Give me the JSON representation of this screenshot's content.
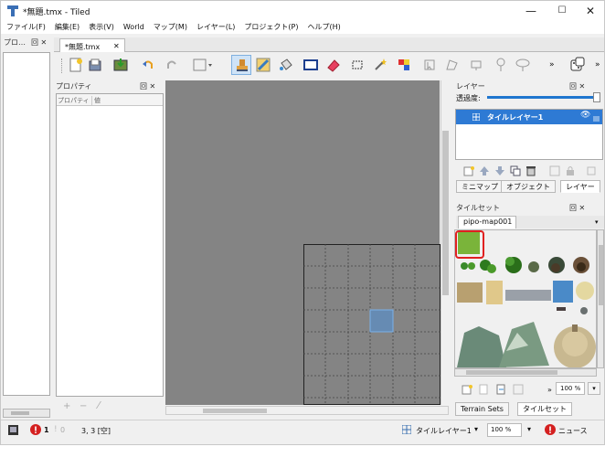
{
  "window": {
    "title": "*無題.tmx - Tiled",
    "min_glyph": "—",
    "max_glyph": "☐",
    "close_glyph": "✕"
  },
  "menu": [
    "ファイル(F)",
    "編集(E)",
    "表示(V)",
    "World",
    "マップ(M)",
    "レイヤー(L)",
    "プロジェクト(P)",
    "ヘルプ(H)"
  ],
  "left_dock": {
    "title": "プロ…",
    "ctrl": "回 ✕"
  },
  "doc_tab": {
    "label": "*無題.tmx",
    "close": "✕"
  },
  "toolbar": {
    "icons": [
      "new-map-icon",
      "open-icon",
      "save-icon",
      "undo-icon",
      "redo-icon",
      "stamp-tool-icon",
      "terrain-brush-icon",
      "bucket-fill-icon",
      "shape-fill-icon",
      "eraser-icon",
      "rect-select-icon",
      "magic-wand-icon",
      "select-same-tile-icon",
      "object-select-icon",
      "edit-polygon-icon",
      "insert-rect-icon",
      "insert-point-icon",
      "insert-ellipse-icon"
    ],
    "more": "»",
    "more2": "»"
  },
  "properties": {
    "title": "プロパティ",
    "ctrl": "回 ✕",
    "col_property": "プロパティ",
    "col_value": "値",
    "add": "+",
    "remove": "−",
    "edit": "⁄"
  },
  "layers_panel": {
    "title": "レイヤー",
    "ctrl": "回 ✕",
    "opacity_label": "透過度:",
    "opacity": 1.0,
    "items": [
      {
        "name": "タイルレイヤー1",
        "visible_glyph": "👁",
        "selected": true
      }
    ]
  },
  "top_right_tabs": [
    "ミニマップ",
    "オブジェクト",
    "レイヤー"
  ],
  "tilesets_panel": {
    "title": "タイルセット",
    "ctrl": "回 ✕",
    "tab": "pipo-map001",
    "zoom": "100 %",
    "more": "»"
  },
  "bottom_right_tabs": [
    "Terrain Sets",
    "タイルセット"
  ],
  "status": {
    "error_count": "1",
    "warning_count": "0",
    "coords": "3, 3 [空]",
    "layer_select": "タイルレイヤー1",
    "zoom": "100 %",
    "news": "ニュース"
  },
  "colors": {
    "accent": "#0078d7",
    "selected_layer": "#2e7ad4",
    "highlight_red": "#e02020"
  }
}
